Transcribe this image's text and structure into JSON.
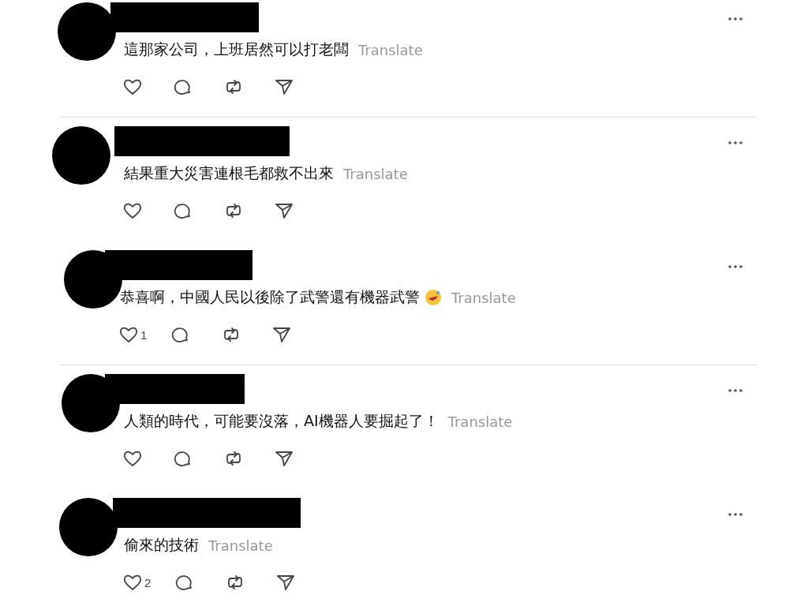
{
  "posts": [
    {
      "text": "這那家公司，上班居然可以打老闆",
      "translate": "Translate",
      "emoji": false
    },
    {
      "text": "結果重大災害連根毛都救不出來",
      "translate": "Translate",
      "emoji": false
    },
    {
      "text": "恭喜啊，中國人民以後除了武警還有機器武警",
      "translate": "Translate",
      "emoji": true,
      "likes": "1"
    },
    {
      "text": "人類的時代，可能要沒落，AI機器人要掘起了！",
      "translate": "Translate",
      "emoji": false
    },
    {
      "text": "偷來的技術",
      "translate": "Translate",
      "emoji": false,
      "likes": "2"
    }
  ]
}
